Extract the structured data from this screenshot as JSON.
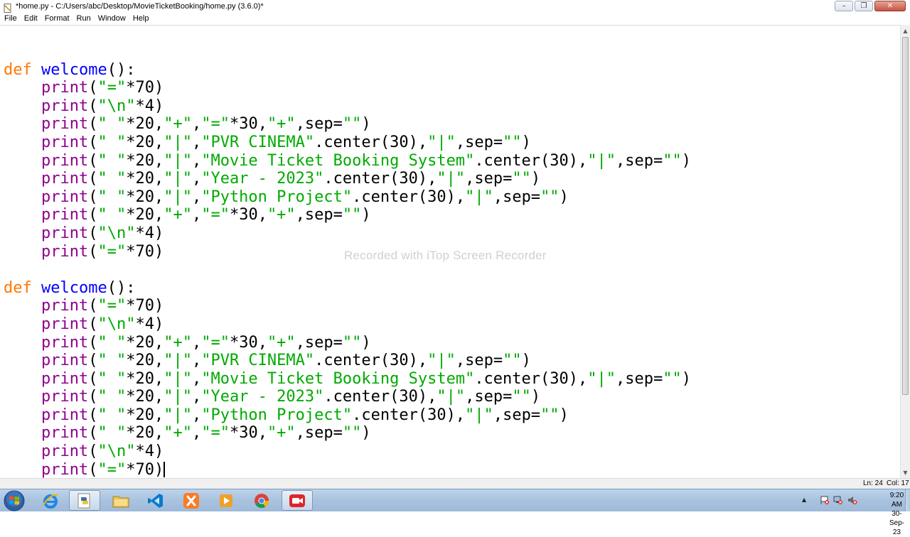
{
  "window": {
    "title": "*home.py - C:/Users/abc/Desktop/MovieTicketBooking/home.py (3.6.0)*"
  },
  "menu": [
    "File",
    "Edit",
    "Format",
    "Run",
    "Window",
    "Help"
  ],
  "code_lines": [
    "",
    "def welcome():",
    "    print(\"=\"*70)",
    "    print(\"\\n\"*4)",
    "    print(\" \"*20,\"+\",\"=\"*30,\"+\",sep=\"\")",
    "    print(\" \"*20,\"|\",\"PVR CINEMA\".center(30),\"|\",sep=\"\")",
    "    print(\" \"*20,\"|\",\"Movie Ticket Booking System\".center(30),\"|\",sep=\"\")",
    "    print(\" \"*20,\"|\",\"Year - 2023\".center(30),\"|\",sep=\"\")",
    "    print(\" \"*20,\"|\",\"Python Project\".center(30),\"|\",sep=\"\")",
    "    print(\" \"*20,\"+\",\"=\"*30,\"+\",sep=\"\")",
    "    print(\"\\n\"*4)",
    "    print(\"=\"*70)",
    "",
    "def welcome():",
    "    print(\"=\"*70)",
    "    print(\"\\n\"*4)",
    "    print(\" \"*20,\"+\",\"=\"*30,\"+\",sep=\"\")",
    "    print(\" \"*20,\"|\",\"PVR CINEMA\".center(30),\"|\",sep=\"\")",
    "    print(\" \"*20,\"|\",\"Movie Ticket Booking System\".center(30),\"|\",sep=\"\")",
    "    print(\" \"*20,\"|\",\"Year - 2023\".center(30),\"|\",sep=\"\")",
    "    print(\" \"*20,\"|\",\"Python Project\".center(30),\"|\",sep=\"\")",
    "    print(\" \"*20,\"+\",\"=\"*30,\"+\",sep=\"\")",
    "    print(\"\\n\"*4)",
    "    print(\"=\"*70)"
  ],
  "status": {
    "ln": "Ln: 24",
    "col": "Col: 17"
  },
  "watermark": "Recorded with iTop Screen Recorder",
  "clock": {
    "time": "9:20 AM",
    "date": "30-Sep-23"
  },
  "taskbar_apps": [
    {
      "name": "ie-icon"
    },
    {
      "name": "python-idle-icon",
      "active": true
    },
    {
      "name": "file-explorer-icon"
    },
    {
      "name": "vscode-icon"
    },
    {
      "name": "xampp-icon"
    },
    {
      "name": "media-player-icon"
    },
    {
      "name": "chrome-icon"
    },
    {
      "name": "itop-recorder-icon",
      "active": true
    }
  ],
  "colors": {
    "keyword": "#ff7700",
    "definition": "#0000ff",
    "builtin": "#900090",
    "string": "#00aa00"
  }
}
